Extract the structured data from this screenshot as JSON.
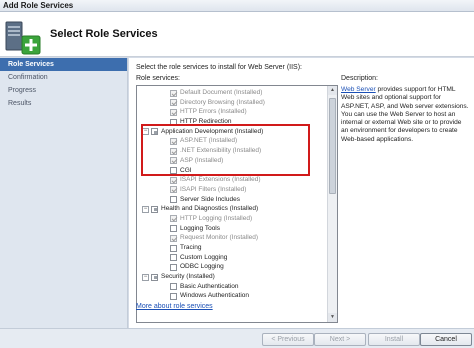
{
  "window": {
    "title": "Add Role Services"
  },
  "header": {
    "heading": "Select Role Services"
  },
  "sidebar": {
    "items": [
      {
        "label": "Role Services",
        "active": true
      },
      {
        "label": "Confirmation",
        "active": false
      },
      {
        "label": "Progress",
        "active": false
      },
      {
        "label": "Results",
        "active": false
      }
    ]
  },
  "main": {
    "intro": "Select the role services to install for Web Server (IIS):",
    "role_services_label": "Role services:",
    "description_label": "Description:",
    "description_link": "Web Server",
    "description_text": " provides support for HTML Web sites and optional support for ASP.NET, ASP, and Web server extensions. You can use the Web Server to host an internal or external Web site or to provide an environment for developers to create Web-based applications.",
    "more_link": "More about role services"
  },
  "tree": [
    {
      "label": "Default Document  (Installed)",
      "level": 2,
      "state": "checked",
      "installed": true
    },
    {
      "label": "Directory Browsing  (Installed)",
      "level": 2,
      "state": "checked",
      "installed": true
    },
    {
      "label": "HTTP Errors  (Installed)",
      "level": 2,
      "state": "checked",
      "installed": true
    },
    {
      "label": "HTTP Redirection",
      "level": 2,
      "state": "unchecked",
      "installed": false
    },
    {
      "label": "Application Development  (Installed)",
      "level": 1,
      "state": "partial",
      "installed": false,
      "expander": "−"
    },
    {
      "label": "ASP.NET  (Installed)",
      "level": 2,
      "state": "checked",
      "installed": true
    },
    {
      "label": ".NET Extensibility  (Installed)",
      "level": 2,
      "state": "checked",
      "installed": true
    },
    {
      "label": "ASP  (Installed)",
      "level": 2,
      "state": "checked",
      "installed": true
    },
    {
      "label": "CGI",
      "level": 2,
      "state": "unchecked",
      "installed": false
    },
    {
      "label": "ISAPI Extensions  (Installed)",
      "level": 2,
      "state": "checked",
      "installed": true
    },
    {
      "label": "ISAPI Filters  (Installed)",
      "level": 2,
      "state": "checked",
      "installed": true
    },
    {
      "label": "Server Side Includes",
      "level": 2,
      "state": "unchecked",
      "installed": false
    },
    {
      "label": "Health and Diagnostics  (Installed)",
      "level": 1,
      "state": "partial",
      "installed": false,
      "expander": "−"
    },
    {
      "label": "HTTP Logging  (Installed)",
      "level": 2,
      "state": "checked",
      "installed": true
    },
    {
      "label": "Logging Tools",
      "level": 2,
      "state": "unchecked",
      "installed": false
    },
    {
      "label": "Request Monitor  (Installed)",
      "level": 2,
      "state": "checked",
      "installed": true
    },
    {
      "label": "Tracing",
      "level": 2,
      "state": "unchecked",
      "installed": false
    },
    {
      "label": "Custom Logging",
      "level": 2,
      "state": "unchecked",
      "installed": false
    },
    {
      "label": "ODBC Logging",
      "level": 2,
      "state": "unchecked",
      "installed": false
    },
    {
      "label": "Security  (Installed)",
      "level": 1,
      "state": "partial",
      "installed": false,
      "expander": "−"
    },
    {
      "label": "Basic Authentication",
      "level": 2,
      "state": "unchecked",
      "installed": false
    },
    {
      "label": "Windows Authentication",
      "level": 2,
      "state": "unchecked",
      "installed": false
    }
  ],
  "footer": {
    "previous": "< Previous",
    "next": "Next >",
    "install": "Install",
    "cancel": "Cancel"
  },
  "colors": {
    "highlight": "#d11a1a",
    "accent": "#3d6eae",
    "link": "#1a4fb5"
  }
}
